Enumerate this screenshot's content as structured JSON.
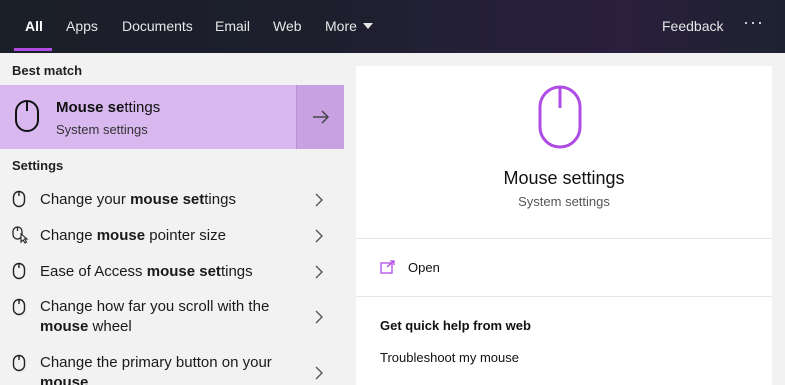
{
  "tabs": [
    {
      "label": "All"
    },
    {
      "label": "Apps"
    },
    {
      "label": "Documents"
    },
    {
      "label": "Email"
    },
    {
      "label": "Web"
    },
    {
      "label": "More"
    }
  ],
  "header": {
    "feedback_label": "Feedback",
    "more_options": "···"
  },
  "left": {
    "best_match_header": "Best match",
    "best_match": {
      "title_bold": "Mouse se",
      "title_rest": "ttings",
      "subtitle": "System settings",
      "icon": "mouse-icon"
    },
    "settings_header": "Settings",
    "items": [
      {
        "pre": "Change your ",
        "bold": "mouse set",
        "post": "tings",
        "icon": "mouse-icon"
      },
      {
        "pre": "Change ",
        "bold": "mouse",
        "post": " pointer size",
        "icon": "mouse-pointer-icon"
      },
      {
        "pre": "Ease of Access ",
        "bold": "mouse set",
        "post": "tings",
        "icon": "mouse-icon"
      },
      {
        "pre": "Change how far you scroll with the ",
        "bold": "mouse",
        "post": " wheel",
        "icon": "mouse-icon"
      },
      {
        "pre": "Change the primary button on your ",
        "bold": "mouse",
        "post": "",
        "icon": "mouse-icon"
      }
    ]
  },
  "right": {
    "title": "Mouse settings",
    "subtitle": "System settings",
    "open_label": "Open",
    "help_title": "Get quick help from web",
    "help_link": "Troubleshoot my mouse"
  },
  "colors": {
    "accent": "#b04ce6",
    "best_bg": "#d9b8f0",
    "best_arrow_bg": "#c8a1e3"
  }
}
